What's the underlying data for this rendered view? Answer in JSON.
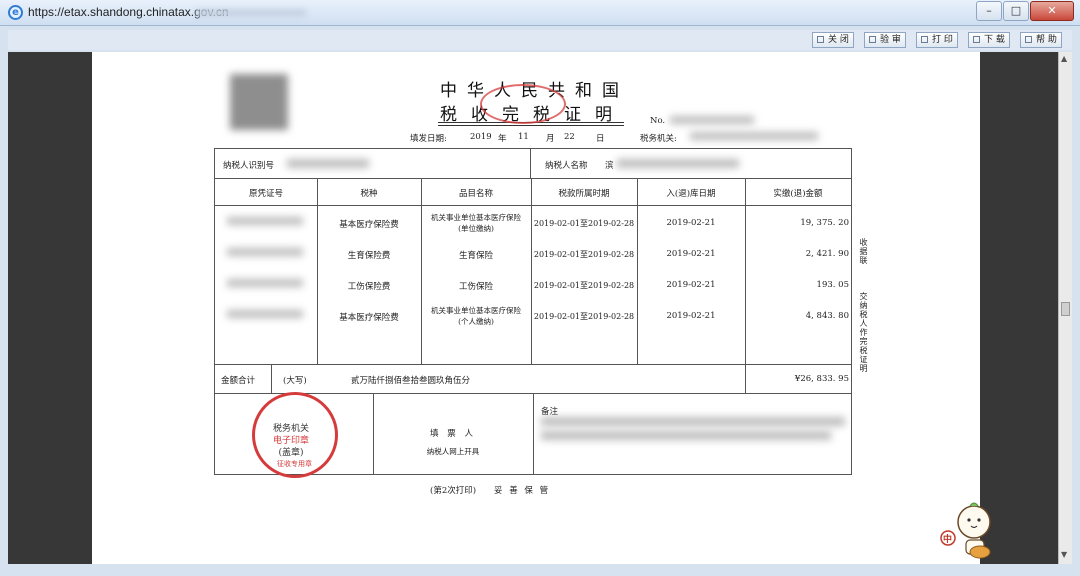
{
  "browser": {
    "url": "https://etax.shandong.chinatax.gov.cn"
  },
  "toolbar": {
    "buttons": [
      "关 闭",
      "验 审",
      "打 印",
      "下 载",
      "帮 助"
    ]
  },
  "certificate": {
    "title_line1": "中华人民共和国",
    "title_line2": "税收完税证明",
    "no_label": "No.",
    "fill_date_label": "填发日期:",
    "fill_date_year": "2019",
    "year_unit": "年",
    "fill_date_month": "11",
    "month_unit": "月",
    "fill_date_day": "22",
    "day_unit": "日",
    "tax_authority_label": "税务机关:",
    "taxpayer_id_label": "纳税人识别号",
    "taxpayer_name_label": "纳税人名称",
    "name_prefix": "滨",
    "headers": [
      "原凭证号",
      "税种",
      "品目名称",
      "税款所属时期",
      "入(退)库日期",
      "实缴(退)金额"
    ],
    "rows": [
      {
        "tax_type": "基本医疗保险费",
        "item_line1": "机关事业单位基本医疗保险",
        "item_line2": "(单位缴纳)",
        "period": "2019-02-01至2019-02-28",
        "date": "2019-02-21",
        "amount": "19, 375. 20"
      },
      {
        "tax_type": "生育保险费",
        "item_line1": "生育保险",
        "item_line2": "",
        "period": "2019-02-01至2019-02-28",
        "date": "2019-02-21",
        "amount": "2, 421. 90"
      },
      {
        "tax_type": "工伤保险费",
        "item_line1": "工伤保险",
        "item_line2": "",
        "period": "2019-02-01至2019-02-28",
        "date": "2019-02-21",
        "amount": "193. 05"
      },
      {
        "tax_type": "基本医疗保险费",
        "item_line1": "机关事业单位基本医疗保险",
        "item_line2": "(个人缴纳)",
        "period": "2019-02-01至2019-02-28",
        "date": "2019-02-21",
        "amount": "4, 843. 80"
      }
    ],
    "total_label": "金额合计",
    "total_capital_label": "(大写)",
    "total_capital": "贰万陆仟捌佰叁拾叁圆玖角伍分",
    "total_amount": "¥26, 833. 95",
    "stamp_line1": "税务机关",
    "stamp_line2": "电子印章",
    "stamp_line3": "(盖章)",
    "stamp_bottom": "征收专用章",
    "filler_label": "填 票 人",
    "filler_value": "纳税人网上开具",
    "remark_label": "备注",
    "side_note_1": "收据联",
    "side_note_2": "交纳税人作完税证明",
    "print_count": "(第2次打印)",
    "keep_safe": "妥 善 保 管"
  },
  "mascot": {
    "badge": "中"
  }
}
